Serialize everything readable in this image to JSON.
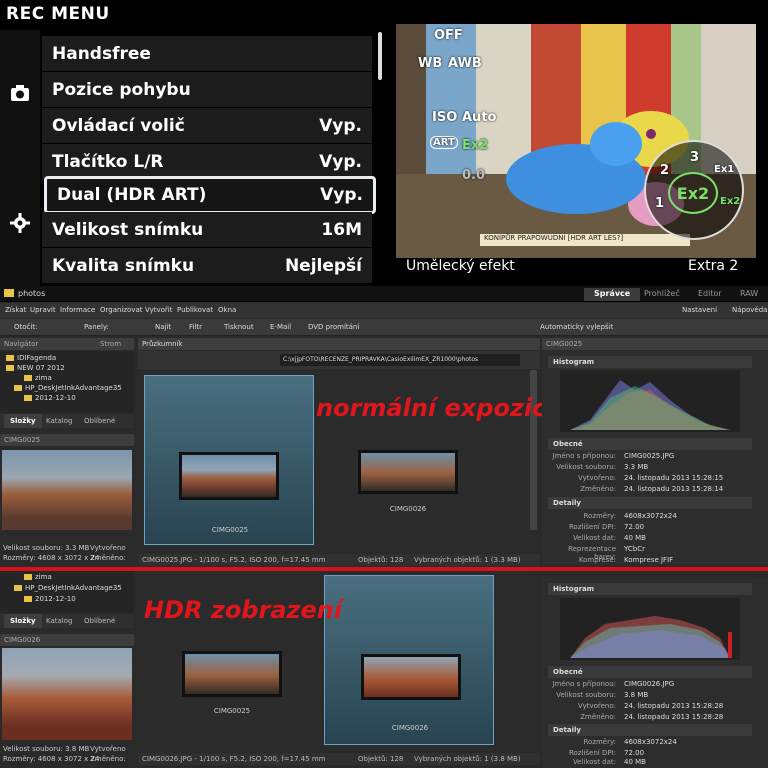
{
  "camera": {
    "title": "REC MENU",
    "menu": [
      {
        "label": "Handsfree",
        "value": ""
      },
      {
        "label": "Pozice pohybu",
        "value": ""
      },
      {
        "label": "Ovládací volič",
        "value": "Vyp."
      },
      {
        "label": "Tlačítko L/R",
        "value": "Vyp."
      },
      {
        "label": "Dual (HDR ART)",
        "value": "Vyp."
      },
      {
        "label": "Velikost snímku",
        "value": "16M"
      },
      {
        "label": "Kvalita snímku",
        "value": "Nejlepší"
      }
    ],
    "preview": {
      "hud": {
        "off": "OFF",
        "wb": "WB",
        "awb": "AWB",
        "iso": "ISO",
        "auto": "Auto",
        "art": "ART",
        "ex2": "Ex2",
        "ev": "0.0"
      },
      "dial": {
        "center": "Ex2",
        "n1": "1",
        "n2": "2",
        "n3": "3",
        "ex1": "Ex1",
        "ex2r": "Ex2"
      },
      "caption_left": "Umělecký efekt",
      "caption_right": "Extra 2",
      "handwriting": "KONIPŮR PRAPOWUDNÍ [HDR ART LES?]"
    }
  },
  "app": {
    "title": "photos",
    "modes": [
      "Správce",
      "Prohlížeč",
      "Editor",
      "RAW"
    ],
    "menu": [
      "Získat",
      "Upravit",
      "Informace",
      "Organizovat",
      "Vytvořit",
      "Publikovat",
      "Okna"
    ],
    "menu_right": {
      "settings": "Nastavení",
      "help": "Nápověda"
    },
    "toolbar": {
      "rotate": "Otočit:",
      "panels": "Panely:",
      "find": "Najít",
      "filter": "Filtr",
      "print": "Tisknout",
      "email": "E-Mail",
      "dvd": "DVD promítání",
      "autoenhance": "Automaticky vylepšit"
    },
    "navigator": {
      "title": "Navigátor",
      "tree": "Strom",
      "tabs": [
        "Složky",
        "Katalog",
        "Oblíbené"
      ]
    },
    "tree_top": [
      "IDIFagenda",
      "NEW 07 2012",
      "zima",
      "HP_DeskJetInkAdvantage35",
      "2012-12-10"
    ],
    "tree_bottom": [
      "zima",
      "HP_DeskJetInkAdvantage35",
      "2012-12-10"
    ],
    "explorer": {
      "title": "Průzkumník",
      "path": "C:\\xjjpFOTO\\RECENZE_PRIPRAVKA\\CasioExilimEX_ZR1000\\photos"
    },
    "top": {
      "preview_label": "CIMG0025",
      "file_size": "Velikost souboru: 3.3 MB",
      "created": "Vytvořeno",
      "dimensions": "Rozměry: 4608 x 3072 x 24",
      "changed": "Změněno:",
      "thumbs": [
        "CIMG0025",
        "CIMG0026"
      ],
      "status_a": "CIMG0025.JPG - 1/100 s, F5.2, ISO 200, f=17.45 mm",
      "status_b": "Objektů: 128",
      "status_c": "Vybraných objektů: 1 (3.3 MB)",
      "overlay": "normální expozice",
      "right_title": "CIMG0025",
      "general": {
        "name": "CIMG0025.JPG",
        "size": "3.3 MB",
        "created": "24. listopadu 2013 15:28:15",
        "changed": "24. listopadu 2013 15:28:14"
      },
      "details": {
        "dims": "4608x3072x24",
        "dpi": "72.00",
        "datasize": "40 MB",
        "colorrep": "YCbCr",
        "compression": "Komprese JFIF"
      }
    },
    "bottom": {
      "preview_label": "CIMG0026",
      "file_size": "Velikost souboru: 3.8 MB",
      "created": "Vytvořeno",
      "dimensions": "Rozměry: 4608 x 3072 x 24",
      "changed": "Změněno:",
      "thumbs": [
        "CIMG0025",
        "CIMG0026"
      ],
      "status_a": "CIMG0026.JPG - 1/100 s, F5.2, ISO 200, f=17.45 mm",
      "status_b": "Objektů: 128",
      "status_c": "Vybraných objektů: 1 (3.8 MB)",
      "overlay": "HDR zobrazení",
      "general": {
        "name": "CIMG0026.JPG",
        "size": "3.8 MB",
        "created": "24. listopadu 2013 15:28:28",
        "changed": "24. listopadu 2013 15:28:28"
      },
      "details": {
        "dims": "4608x3072x24",
        "dpi": "72.00",
        "datasize": "40 MB"
      }
    },
    "labels": {
      "histogram": "Histogram",
      "general": "Obecné",
      "details": "Detaily",
      "k_name": "Jméno s příponou:",
      "k_size": "Velikost souboru:",
      "k_created": "Vytvořeno:",
      "k_changed": "Změněno:",
      "k_dims": "Rozměry:",
      "k_dpi": "Rozlišení DPI:",
      "k_datasize": "Velikost dat:",
      "k_colorrep": "Reprezentace barev:",
      "k_compression": "Komprese:"
    },
    "colors": {
      "overlay_red": "#e1161c",
      "accent": "#6aa3c3"
    }
  }
}
